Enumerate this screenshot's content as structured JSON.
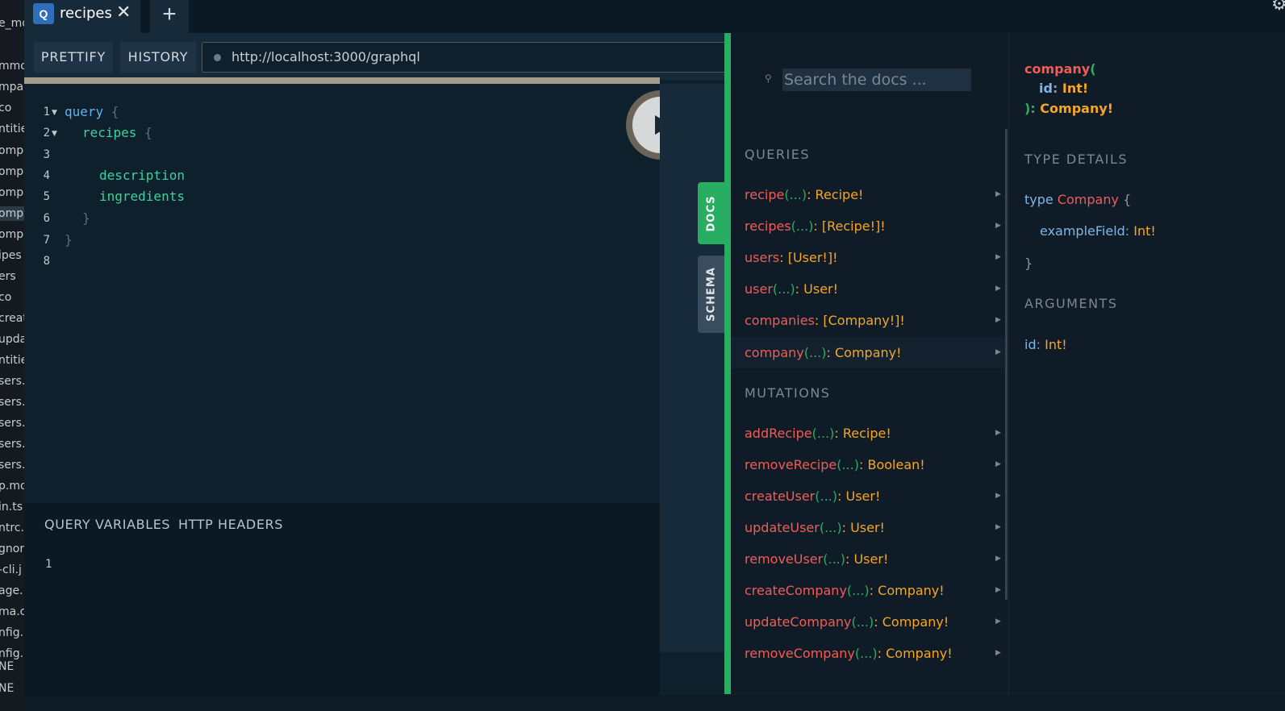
{
  "sidebar_files": [
    "e_mo",
    "mmo",
    "mpa",
    "co",
    "ntitie",
    "ompa",
    "ompa",
    "ompa",
    "ompa",
    "ompa",
    "ipes",
    "ers",
    "co",
    "creat",
    "upda",
    "ntitie",
    "sers.",
    "sers.",
    "sers.",
    "sers.",
    "sers.",
    "p.mo",
    "in.ts",
    "ntrc.",
    "gnor",
    "-cli.j",
    "age.",
    "ma.c",
    "nfig.",
    "nfig.",
    "NE",
    "NE"
  ],
  "tab": {
    "badge": "Q",
    "title": "recipes",
    "close": "✕",
    "add": "+"
  },
  "corner_icon": "⚙",
  "toolbar": {
    "prettify": "PRETTIFY",
    "history": "HISTORY",
    "url": "http://localhost:3000/graphql"
  },
  "editor": {
    "line_numbers": [
      "1",
      "2",
      "3",
      "4",
      "5",
      "6",
      "7",
      "8"
    ],
    "lines": [
      {
        "kw": "query",
        "br": " {"
      },
      {
        "fld": "recipes",
        "br": " {"
      },
      {},
      {
        "fld": "description"
      },
      {
        "fld": "ingredients"
      },
      {
        "br": "}"
      },
      {
        "br": "}"
      },
      {}
    ]
  },
  "side_tabs": {
    "docs": "DOCS",
    "schema": "SCHEMA"
  },
  "variables": {
    "query_variables": "QUERY VARIABLES",
    "http_headers": "HTTP HEADERS",
    "line": "1"
  },
  "docs": {
    "search_placeholder": "Search the docs ...",
    "queries_title": "QUERIES",
    "queries": [
      {
        "name": "recipe",
        "args": "(...)",
        "type": "Recipe!"
      },
      {
        "name": "recipes",
        "args": "(...)",
        "type": "[Recipe!]!"
      },
      {
        "name": "users",
        "args": "",
        "type": "[User!]!"
      },
      {
        "name": "user",
        "args": "(...)",
        "type": "User!"
      },
      {
        "name": "companies",
        "args": "",
        "type": "[Company!]!"
      },
      {
        "name": "company",
        "args": "(...)",
        "type": "Company!"
      }
    ],
    "mutations_title": "MUTATIONS",
    "mutations": [
      {
        "name": "addRecipe",
        "args": "(...)",
        "type": "Recipe!"
      },
      {
        "name": "removeRecipe",
        "args": "(...)",
        "type": "Boolean!"
      },
      {
        "name": "createUser",
        "args": "(...)",
        "type": "User!"
      },
      {
        "name": "updateUser",
        "args": "(...)",
        "type": "User!"
      },
      {
        "name": "removeUser",
        "args": "(...)",
        "type": "User!"
      },
      {
        "name": "createCompany",
        "args": "(...)",
        "type": "Company!"
      },
      {
        "name": "updateCompany",
        "args": "(...)",
        "type": "Company!"
      },
      {
        "name": "removeCompany",
        "args": "(...)",
        "type": "Company!"
      }
    ],
    "detail": {
      "name": "company",
      "arg_name": "id",
      "arg_type": "Int!",
      "return_type": "Company!",
      "type_details_title": "TYPE DETAILS",
      "type_keyword": "type",
      "type_name": "Company",
      "field_name": "exampleField",
      "field_type": "Int!",
      "arguments_title": "ARGUMENTS"
    }
  }
}
